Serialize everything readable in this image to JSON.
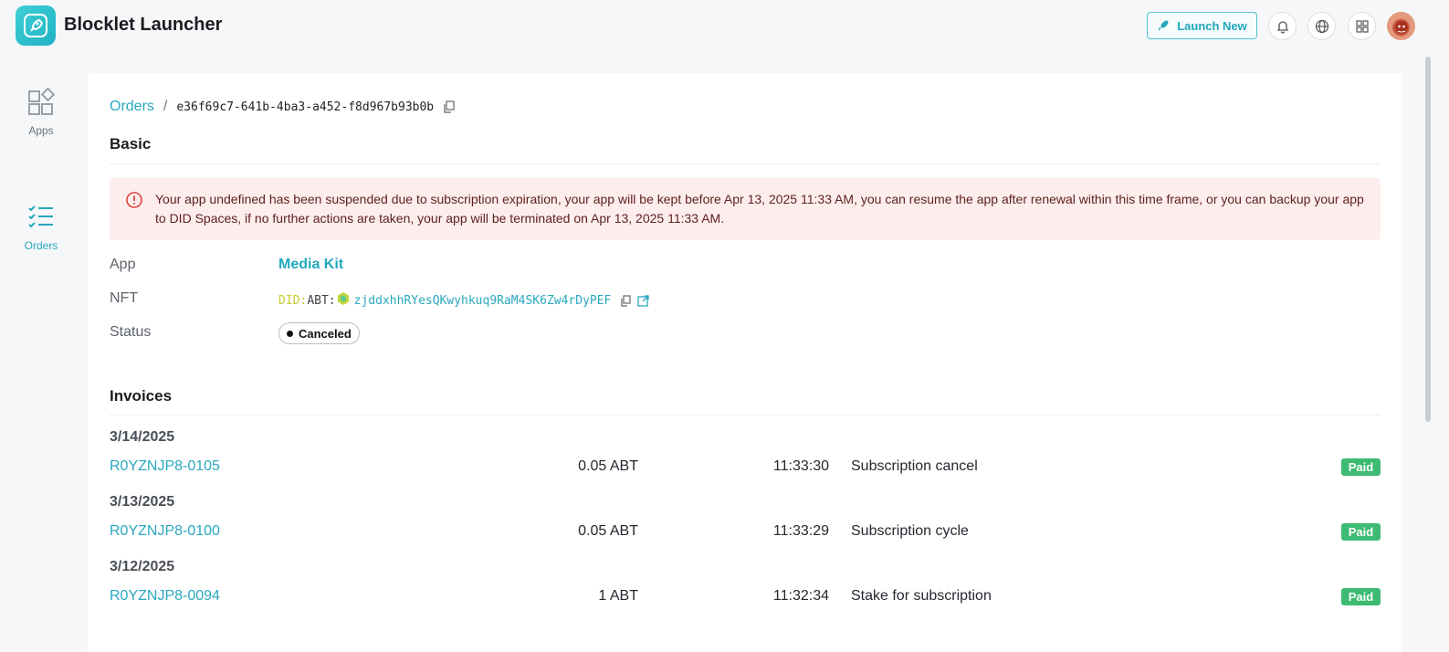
{
  "header": {
    "app_title": "Blocklet Launcher",
    "launch_label": "Launch New",
    "icons": [
      "rocket-icon",
      "bell-icon",
      "globe-icon",
      "apps-grid-icon",
      "avatar"
    ]
  },
  "sidebar": {
    "items": [
      {
        "label": "Apps",
        "icon": "apps-icon",
        "active": false
      },
      {
        "label": "Orders",
        "icon": "orders-list-icon",
        "active": true
      }
    ]
  },
  "breadcrumb": {
    "parent": "Orders",
    "separator": "/",
    "current": "e36f69c7-641b-4ba3-a452-f8d967b93b0b"
  },
  "basic": {
    "title": "Basic",
    "alert": "Your app undefined has been suspended due to subscription expiration, your app will be kept before Apr 13, 2025 11:33 AM, you can resume the app after renewal within this time frame, or you can backup your app to DID Spaces, if no further actions are taken, your app will be terminated on Apr 13, 2025 11:33 AM.",
    "app_label": "App",
    "app_value": "Media Kit",
    "nft_label": "NFT",
    "nft_did": "DID:",
    "nft_abt": "ABT:",
    "nft_address": "zjddxhhRYesQKwyhkuq9RaM4SK6Zw4rDyPEF",
    "status_label": "Status",
    "status_value": "Canceled"
  },
  "invoices": {
    "title": "Invoices",
    "groups": [
      {
        "date": "3/14/2025",
        "id": "R0YZNJP8-0105",
        "amount": "0.05 ABT",
        "time": "11:33:30",
        "description": "Subscription cancel",
        "status": "Paid"
      },
      {
        "date": "3/13/2025",
        "id": "R0YZNJP8-0100",
        "amount": "0.05 ABT",
        "time": "11:33:29",
        "description": "Subscription cycle",
        "status": "Paid"
      },
      {
        "date": "3/12/2025",
        "id": "R0YZNJP8-0094",
        "amount": "1 ABT",
        "time": "11:32:34",
        "description": "Stake for subscription",
        "status": "Paid"
      }
    ]
  },
  "colors": {
    "accent": "#2aa8bf",
    "paid": "#3dbb72",
    "alert_bg": "#fdeeed",
    "alert_icon": "#d9453c"
  }
}
